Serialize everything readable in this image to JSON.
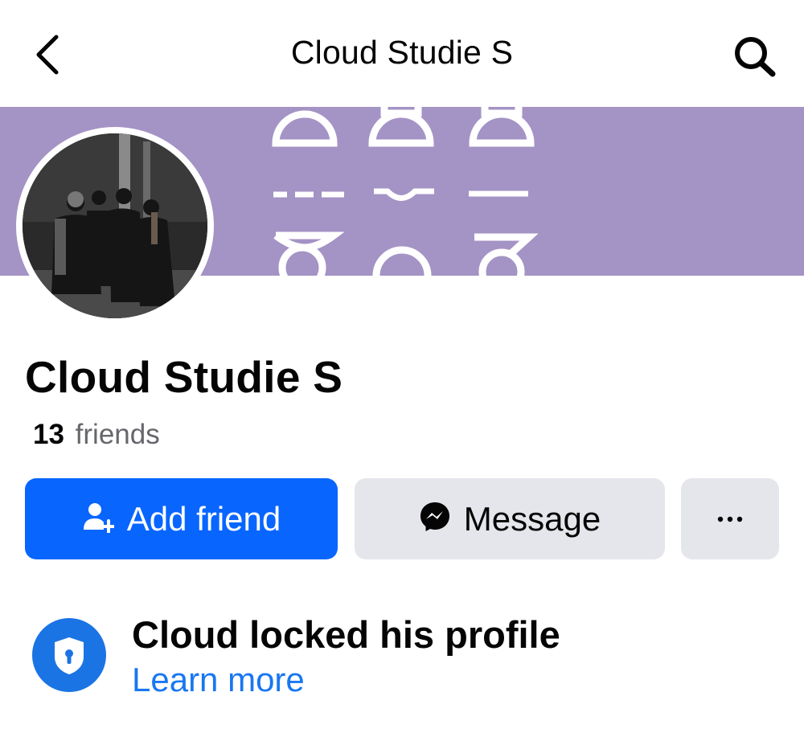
{
  "header": {
    "title": "Cloud Studie S",
    "back_icon": "chevron-left-icon",
    "search_icon": "search-icon"
  },
  "profile": {
    "name": "Cloud Studie S",
    "friends_count": "13",
    "friends_label": "friends"
  },
  "actions": {
    "add_friend_label": "Add friend",
    "add_friend_icon": "add-person-icon",
    "message_label": "Message",
    "message_icon": "messenger-icon",
    "more_icon": "more-icon"
  },
  "privacy": {
    "title": "Cloud locked his profile",
    "link": "Learn more",
    "icon": "shield-lock-icon"
  },
  "colors": {
    "primary": "#0866ff",
    "link": "#1877f2",
    "cover": "#a190c2",
    "secondary_button": "#e4e6eb"
  }
}
